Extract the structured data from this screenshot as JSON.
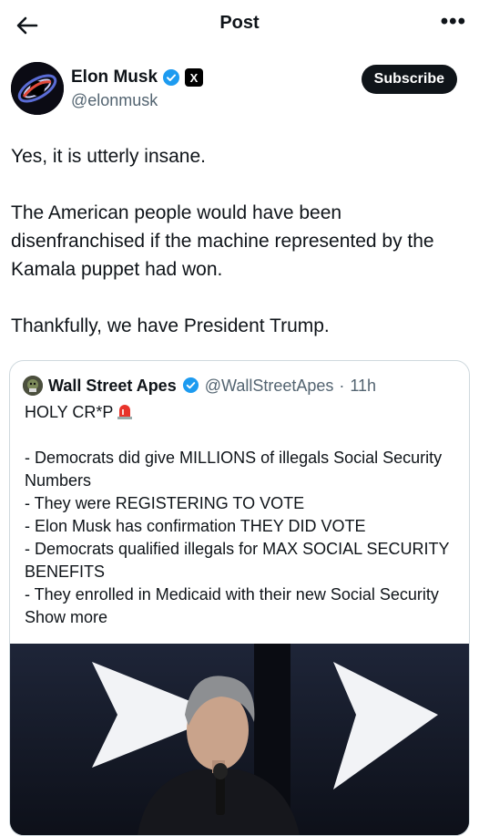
{
  "header": {
    "title": "Post",
    "back_icon": "back-arrow-icon",
    "more_icon": "more-dots-icon"
  },
  "author": {
    "name": "Elon Musk",
    "handle": "@elonmusk",
    "verified_color": "#1d9bf0",
    "subscribe_label": "Subscribe"
  },
  "post": {
    "paragraphs": [
      "Yes, it is utterly insane.",
      "The American people would have been disenfranchised if the machine represented by the Kamala puppet had won.",
      "Thankfully, we have President Trump."
    ]
  },
  "quote": {
    "name": "Wall Street Apes",
    "handle": "@WallStreetApes",
    "dot": "·",
    "time": "11h",
    "headline": "HOLY CR*P",
    "lines": [
      "- Democrats did give MILLIONS of illegals Social Security Numbers",
      "- They were REGISTERING TO VOTE",
      "- Elon Musk has confirmation THEY DID VOTE",
      "- Democrats qualified illegals for MAX SOCIAL SECURITY BENEFITS"
    ],
    "last_line": "- They enrolled in Medicaid with their new Social Security",
    "show_more": "Show more"
  },
  "colors": {
    "accent": "#1d9bf0",
    "text": "#0f1419",
    "muted": "#536471",
    "border": "#cfd9de"
  }
}
